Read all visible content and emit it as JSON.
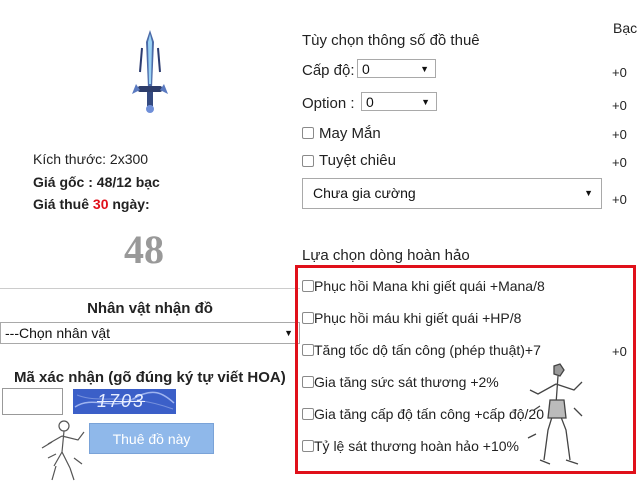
{
  "item": {
    "size": "Kích thước: 2x300",
    "base_price": "Giá gốc : 48/12 bạc",
    "rent_prefix": "Giá thuê ",
    "rent_days": "30",
    "rent_suffix": " ngày:",
    "price_big": "48"
  },
  "receiver": {
    "title": "Nhân vật nhận đồ",
    "select_value": "---Chọn nhân vật"
  },
  "captcha": {
    "label": "Mã xác nhận (gõ đúng ký tự viết HOA)",
    "input_value": "",
    "image_text": "1703"
  },
  "rent_button": "Thuê đồ này",
  "options": {
    "header": "Tùy chọn thông số đồ thuê",
    "currency_header": "Bạc",
    "level_label": "Cấp độ:",
    "level_value": "0",
    "option_label": "Option :",
    "option_value": "0",
    "luck_label": "May Mắn",
    "skill_label": "Tuyệt chiêu",
    "enhance_value": "Chưa gia cường",
    "plus_values": [
      "+0",
      "+0",
      "+0",
      "+0",
      "+0"
    ]
  },
  "excellent": {
    "header": "Lựa chọn dòng hoàn hảo",
    "items": [
      "Phục hồi Mana khi giết quái +Mana/8",
      "Phục hồi máu khi giết quái +HP/8",
      "Tăng tốc dộ tấn công (phép thuật)+7",
      "Gia tăng sức sát thương +2%",
      "Gia tăng cấp độ tấn công +cấp độ/20",
      "Tỷ lệ sát thương hoàn hảo +10%"
    ],
    "row_plus": "+0"
  },
  "colors": {
    "accent_red": "#e0101a",
    "button_blue": "#8fb8ea",
    "captcha_blue": "#3b5fc8"
  },
  "icons": [
    "sword-icon",
    "character-sketch-icon"
  ]
}
